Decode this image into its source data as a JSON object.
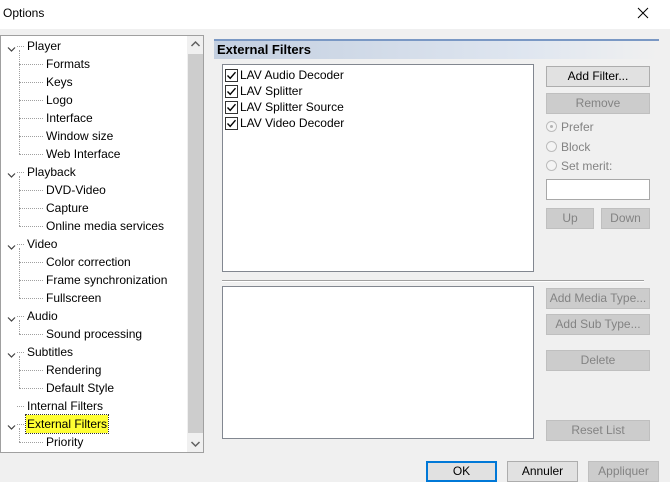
{
  "window": {
    "title": "Options"
  },
  "tree": {
    "items": [
      {
        "label": "Player",
        "level": 0,
        "expanded": true
      },
      {
        "label": "Formats",
        "level": 1
      },
      {
        "label": "Keys",
        "level": 1
      },
      {
        "label": "Logo",
        "level": 1
      },
      {
        "label": "Interface",
        "level": 1
      },
      {
        "label": "Window size",
        "level": 1
      },
      {
        "label": "Web Interface",
        "level": 1
      },
      {
        "label": "Playback",
        "level": 0,
        "expanded": true
      },
      {
        "label": "DVD-Video",
        "level": 1
      },
      {
        "label": "Capture",
        "level": 1
      },
      {
        "label": "Online media services",
        "level": 1
      },
      {
        "label": "Video",
        "level": 0,
        "expanded": true
      },
      {
        "label": "Color correction",
        "level": 1
      },
      {
        "label": "Frame synchronization",
        "level": 1
      },
      {
        "label": "Fullscreen",
        "level": 1
      },
      {
        "label": "Audio",
        "level": 0,
        "expanded": true
      },
      {
        "label": "Sound processing",
        "level": 1
      },
      {
        "label": "Subtitles",
        "level": 0,
        "expanded": true
      },
      {
        "label": "Rendering",
        "level": 1
      },
      {
        "label": "Default Style",
        "level": 1
      },
      {
        "label": "Internal Filters",
        "level": 0
      },
      {
        "label": "External Filters",
        "level": 0,
        "expanded": true,
        "selected": true
      },
      {
        "label": "Priority",
        "level": 1
      }
    ]
  },
  "page": {
    "header": "External Filters",
    "filters": [
      {
        "label": "LAV Audio Decoder",
        "checked": true
      },
      {
        "label": "LAV Splitter",
        "checked": true
      },
      {
        "label": "LAV Splitter Source",
        "checked": true
      },
      {
        "label": "LAV Video Decoder",
        "checked": true
      }
    ],
    "buttons": {
      "add_filter": "Add Filter...",
      "remove": "Remove",
      "up": "Up",
      "down": "Down",
      "add_media_type": "Add Media Type...",
      "add_sub_type": "Add Sub Type...",
      "delete": "Delete",
      "reset_list": "Reset List"
    },
    "merit": {
      "prefer": "Prefer",
      "block": "Block",
      "set_merit": "Set merit:",
      "selected": "prefer",
      "value": ""
    }
  },
  "footer": {
    "ok": "OK",
    "cancel": "Annuler",
    "apply": "Appliquer"
  },
  "colors": {
    "selection_highlight": "#ffff33",
    "header_gradient": "#c3cfe0",
    "default_button_border": "#0078d7"
  }
}
